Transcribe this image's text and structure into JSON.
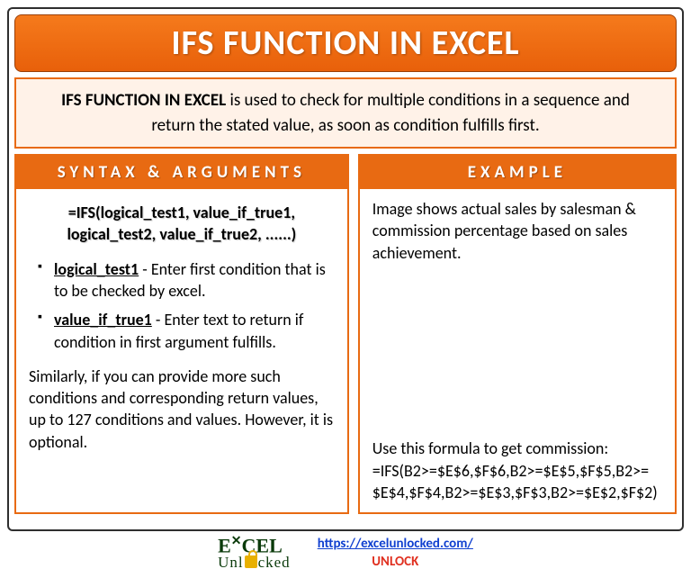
{
  "title": "IFS FUNCTION IN EXCEL",
  "intro": {
    "lead": "IFS FUNCTION IN EXCEL",
    "rest": " is used to check for multiple conditions in a sequence and return the stated value, as soon as condition fulfills first."
  },
  "left": {
    "heading": "SYNTAX & ARGUMENTS",
    "formula": "=IFS(logical_test1, value_if_true1, logical_test2, value_if_true2, ......)",
    "args": [
      {
        "name": "logical_test1",
        "desc": " - Enter first condition that is to be checked by excel."
      },
      {
        "name": "value_if_true1",
        "desc": " - Enter text to return if condition in first argument fulfills."
      }
    ],
    "note": "Similarly, if you can provide more such conditions and corresponding return values, up to 127 conditions and values. However, it is optional."
  },
  "right": {
    "heading": "EXAMPLE",
    "intro": "Image shows actual sales by salesman & commission percentage based on sales achievement.",
    "formula_label": "Use this formula to get commission:",
    "formula": "=IFS(B2>=$E$6,$F$6,B2>=$E$5,$F$5,B2>=$E$4,$F$4,B2>=$E$3,$F$3,B2>=$E$2,$F$2)"
  },
  "footer": {
    "logo_top": "EXCEL",
    "logo_sub": "Unl  cked",
    "url": "https://excelunlocked.com/",
    "unlock": "UNLOCK"
  }
}
